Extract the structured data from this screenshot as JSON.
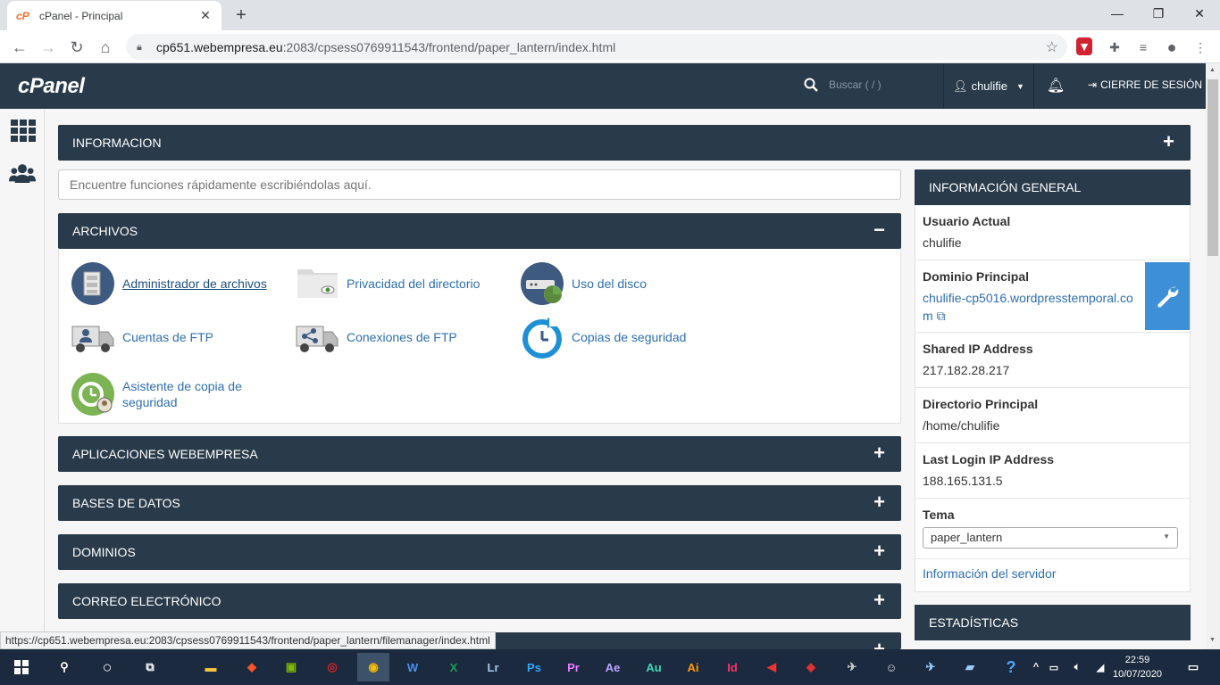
{
  "browser": {
    "tab_title": "cPanel - Principal",
    "url_host": "cp651.webempresa.eu",
    "url_rest": ":2083/cpsess0769911543/frontend/paper_lantern/index.html",
    "status_url": "https://cp651.webempresa.eu:2083/cpsess0769911543/frontend/paper_lantern/filemanager/index.html"
  },
  "cpanel": {
    "logo": "cPanel",
    "search_placeholder": "Buscar ( / )",
    "user": "chulifie",
    "logout": "CIERRE DE SESIÓN"
  },
  "main": {
    "informacion": "INFORMACION",
    "find_placeholder": "Encuentre funciones rápidamente escribiéndolas aquí.",
    "archivos": {
      "title": "ARCHIVOS",
      "items": [
        {
          "label": "Administrador de archivos",
          "icon": "file-manager-icon"
        },
        {
          "label": "Privacidad del directorio",
          "icon": "directory-privacy-icon"
        },
        {
          "label": "Uso del disco",
          "icon": "disk-usage-icon"
        },
        {
          "label": "Cuentas de FTP",
          "icon": "ftp-accounts-icon"
        },
        {
          "label": "Conexiones de FTP",
          "icon": "ftp-connections-icon"
        },
        {
          "label": "Copias de seguridad",
          "icon": "backup-icon"
        },
        {
          "label": "Asistente de copia de seguridad",
          "icon": "backup-wizard-icon"
        }
      ]
    },
    "sections": [
      "APLICACIONES WEBEMPRESA",
      "BASES DE DATOS",
      "DOMINIOS",
      "CORREO ELECTRÓNICO"
    ]
  },
  "general": {
    "title": "INFORMACIÓN GENERAL",
    "usuario_label": "Usuario Actual",
    "usuario_val": "chulifie",
    "dominio_label": "Dominio Principal",
    "dominio_val": "chulifie-cp5016.wordpresstemporal.com",
    "ip_label": "Shared IP Address",
    "ip_val": "217.182.28.217",
    "dir_label": "Directorio Principal",
    "dir_val": "/home/chulifie",
    "last_label": "Last Login IP Address",
    "last_val": "188.165.131.5",
    "tema_label": "Tema",
    "tema_val": "paper_lantern",
    "server_link": "Información del servidor",
    "stats": "ESTADÍSTICAS"
  },
  "taskbar": {
    "time": "22:59",
    "date": "10/07/2020"
  }
}
